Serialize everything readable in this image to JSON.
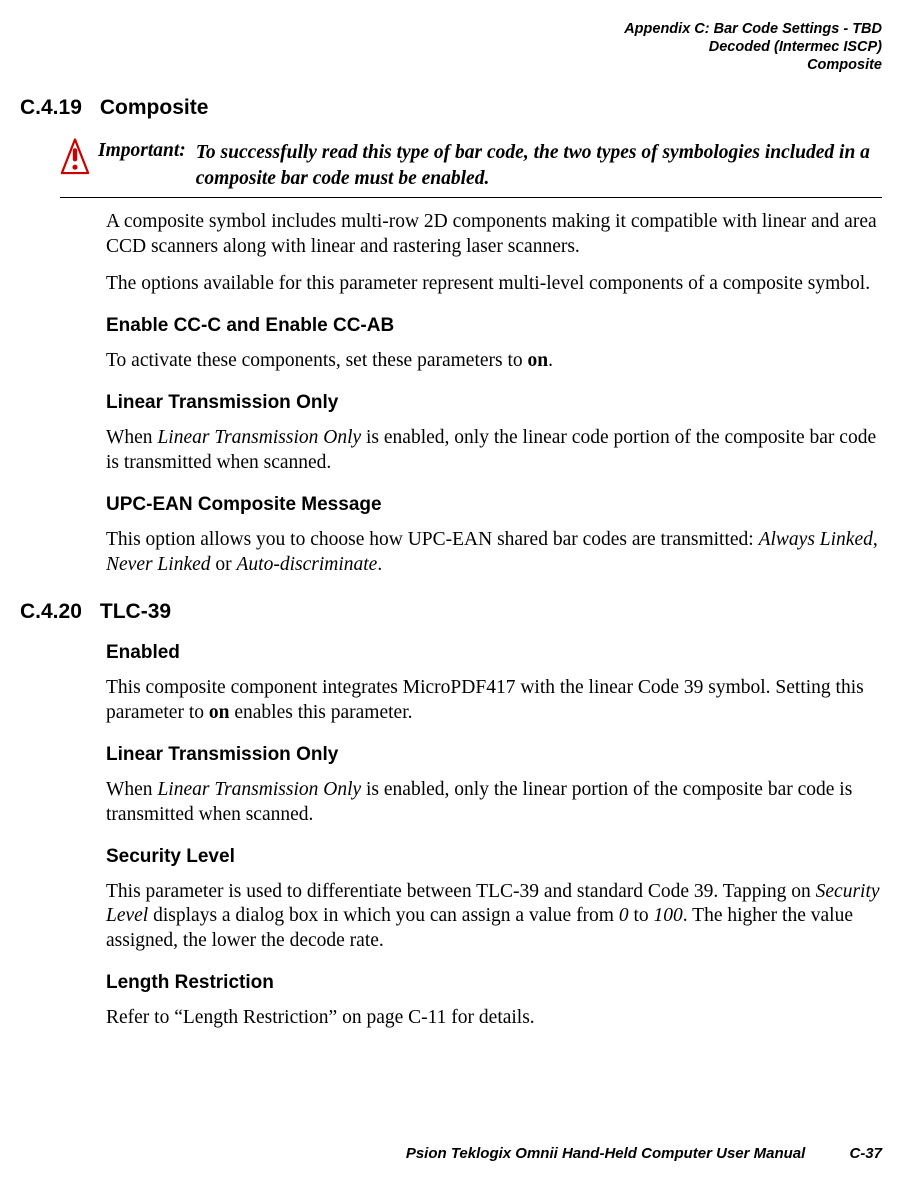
{
  "header": {
    "line1": "Appendix C: Bar Code Settings - TBD",
    "line2": "Decoded (Intermec ISCP)",
    "line3": "Composite"
  },
  "s1": {
    "num": "C.4.19",
    "title": "Composite",
    "callout_label": "Important:",
    "callout_text": "To successfully read this type of bar code, the two types of symbologies included in a composite bar code must be enabled.",
    "p1": "A composite symbol includes multi-row 2D components making it compatible with linear and area CCD scanners along with linear and rastering laser scanners.",
    "p2": "The options available for this parameter represent multi-level components of a composite symbol.",
    "h1": "Enable CC-C and Enable CC-AB",
    "p3a": "To activate these components, set these parameters to ",
    "p3b": "on",
    "p3c": ".",
    "h2": "Linear Transmission Only",
    "p4a": "When ",
    "p4b": "Linear Transmission Only",
    "p4c": " is enabled, only the linear code portion of the composite bar code is transmitted when scanned.",
    "h3": "UPC-EAN Composite Message",
    "p5a": "This option allows you to choose how UPC-EAN shared bar codes are transmitted: ",
    "p5b": "Always Linked",
    "p5c": ", ",
    "p5d": "Never Linked",
    "p5e": " or ",
    "p5f": "Auto-discriminate",
    "p5g": "."
  },
  "s2": {
    "num": "C.4.20",
    "title": "TLC-39",
    "h1": "Enabled",
    "p1a": "This composite component integrates MicroPDF417 with the linear Code 39 symbol. Setting this parameter to ",
    "p1b": "on",
    "p1c": " enables this parameter.",
    "h2": "Linear Transmission Only",
    "p2a": "When ",
    "p2b": "Linear Transmission Only",
    "p2c": " is enabled, only the linear portion of the composite bar code is transmitted when scanned.",
    "h3": "Security Level",
    "p3a": "This parameter is used to differentiate between TLC-39 and standard Code 39. Tapping on ",
    "p3b": "Security Level",
    "p3c": " displays a dialog box in which you can assign a value from ",
    "p3d": "0",
    "p3e": " to ",
    "p3f": "100",
    "p3g": ". The higher the value assigned, the lower the decode rate.",
    "h4": "Length Restriction",
    "p4": "Refer to “Length Restriction” on page C-11 for details."
  },
  "footer": {
    "title": "Psion Teklogix Omnii Hand-Held Computer User Manual",
    "page": "C-37"
  }
}
